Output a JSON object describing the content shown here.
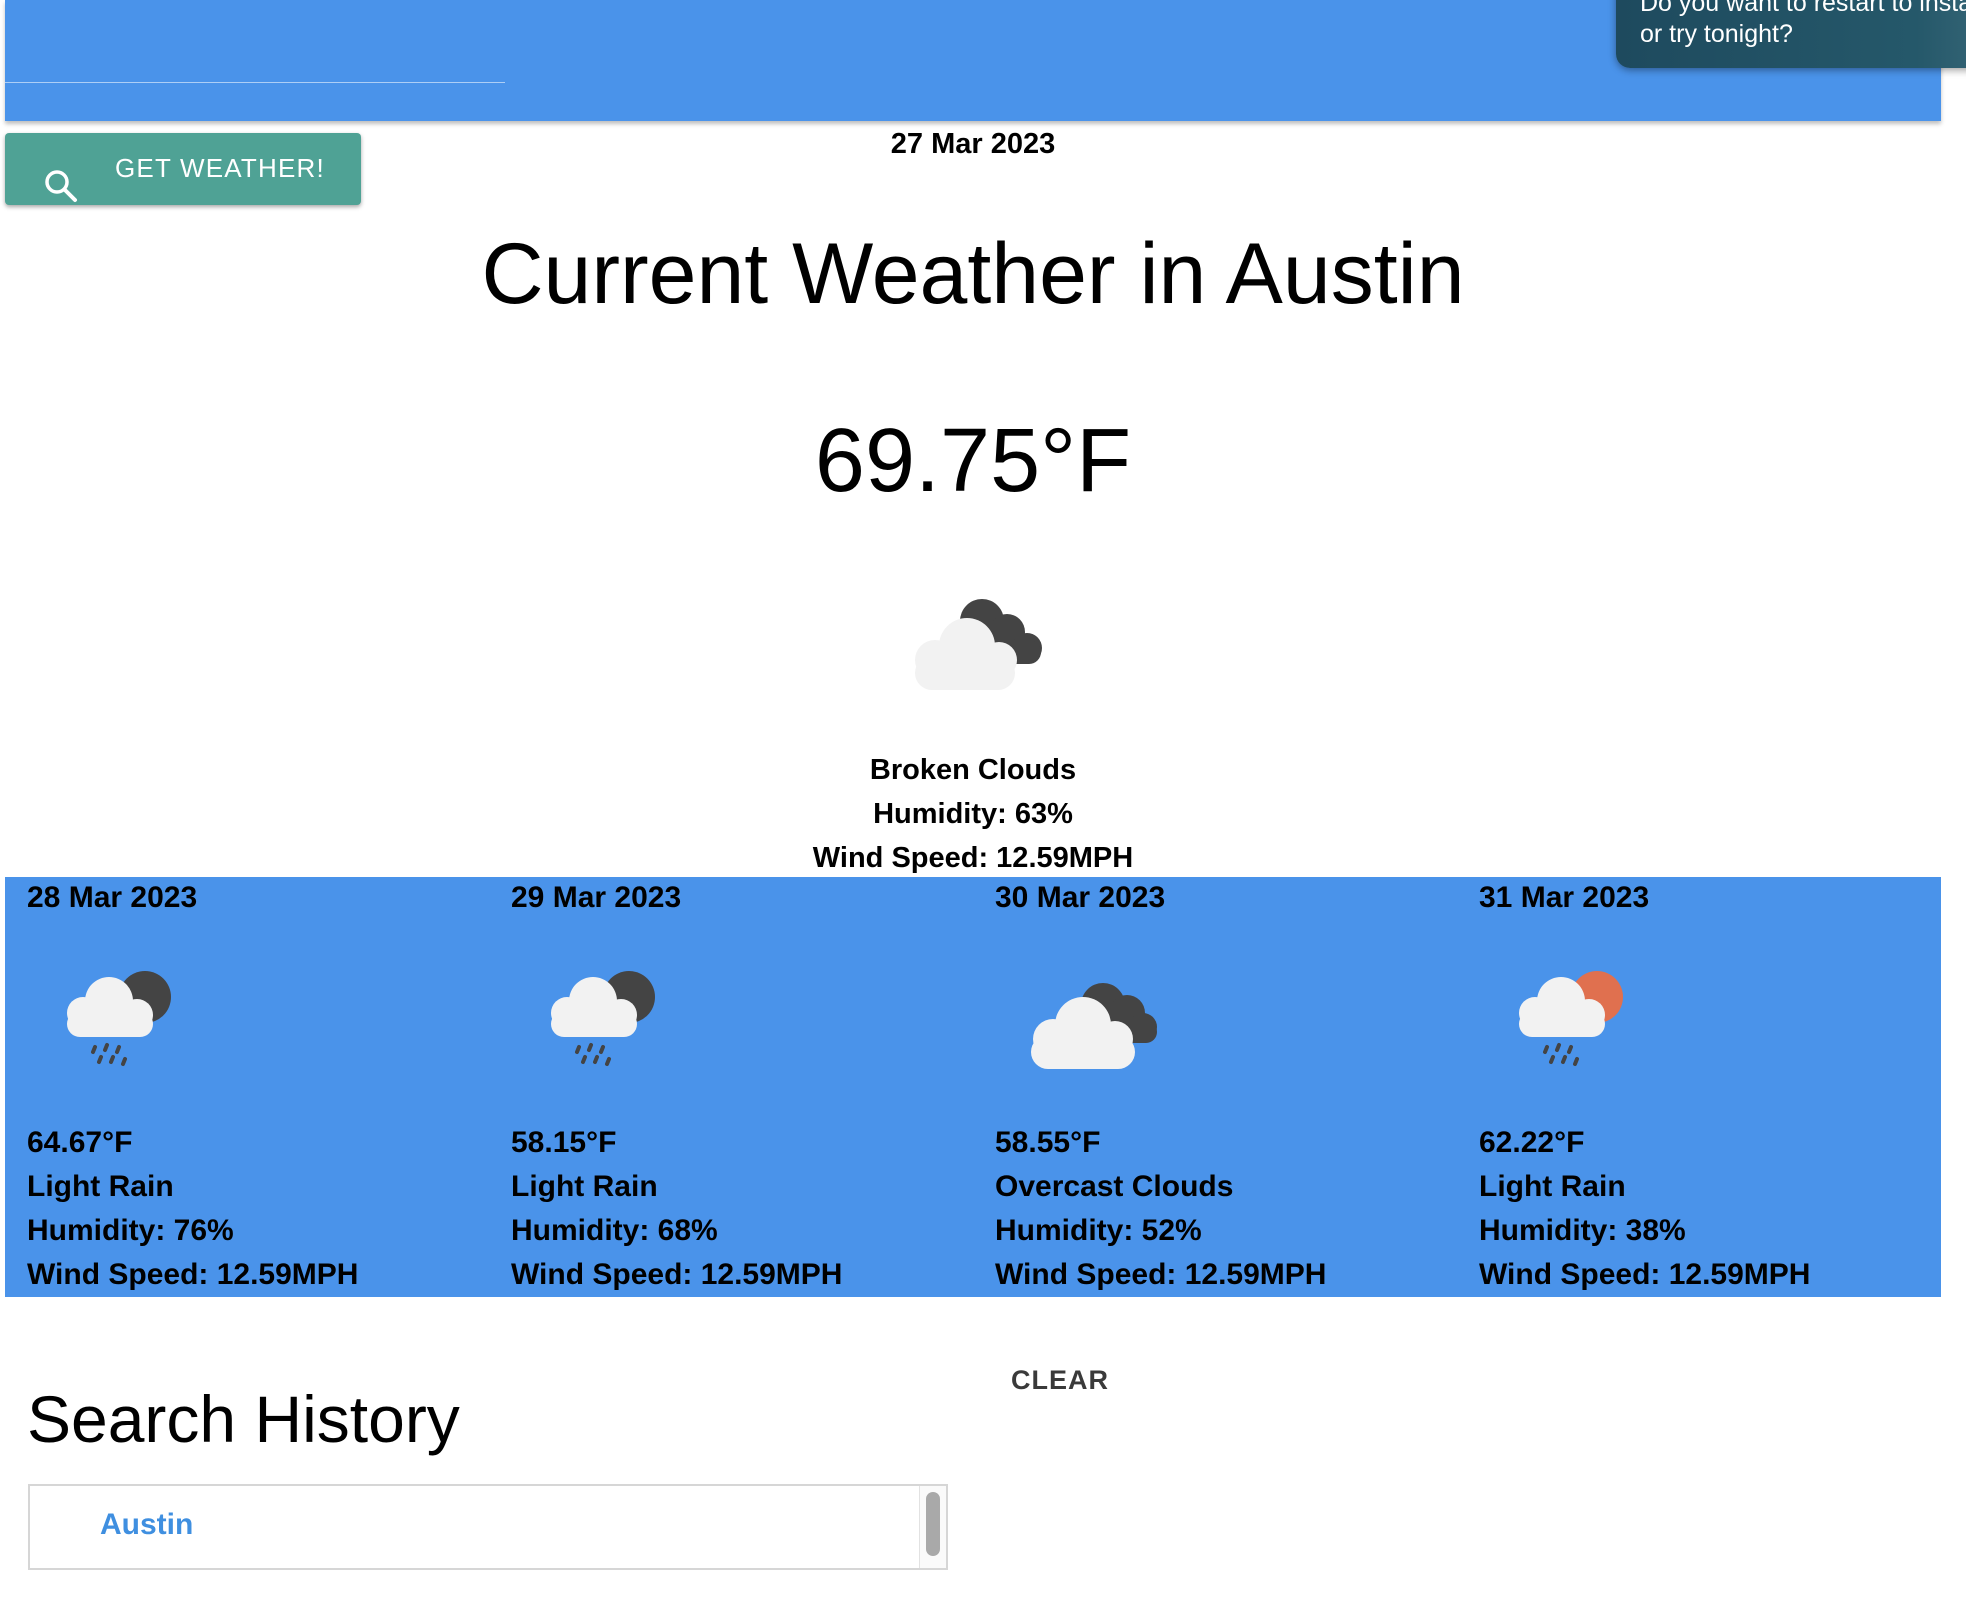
{
  "notification": {
    "line1": "Do you want to restart to install",
    "line2": "or try tonight?"
  },
  "search": {
    "button_label": "GET WEATHER!",
    "button_icon": "search-icon"
  },
  "current": {
    "date": "27 Mar 2023",
    "title": "Current Weather in Austin",
    "temperature": "69.75°F",
    "icon": "broken-clouds-icon",
    "description": "Broken Clouds",
    "humidity": "Humidity: 63%",
    "wind": "Wind Speed: 12.59MPH"
  },
  "forecast": [
    {
      "date": "28 Mar 2023",
      "icon": "rain-moon-icon",
      "temperature": "64.67°F",
      "description": "Light Rain",
      "humidity": "Humidity: 76%",
      "wind": "Wind Speed: 12.59MPH"
    },
    {
      "date": "29 Mar 2023",
      "icon": "rain-moon-icon",
      "temperature": "58.15°F",
      "description": "Light Rain",
      "humidity": "Humidity: 68%",
      "wind": "Wind Speed: 12.59MPH"
    },
    {
      "date": "30 Mar 2023",
      "icon": "overcast-clouds-icon",
      "temperature": "58.55°F",
      "description": "Overcast Clouds",
      "humidity": "Humidity: 52%",
      "wind": "Wind Speed: 12.59MPH"
    },
    {
      "date": "31 Mar 2023",
      "icon": "rain-sun-icon",
      "temperature": "62.22°F",
      "description": "Light Rain",
      "humidity": "Humidity: 38%",
      "wind": "Wind Speed: 12.59MPH"
    }
  ],
  "history": {
    "clear_label": "CLEAR",
    "title": "Search History",
    "items": [
      "Austin"
    ]
  },
  "colors": {
    "header": "#4a93ea",
    "forecast_bg": "#4a93ea",
    "button": "#4fa295",
    "link": "#3f8fe0",
    "sun": "#e0704f",
    "dark_cloud": "#444444",
    "light_cloud": "#f2f2f2"
  }
}
